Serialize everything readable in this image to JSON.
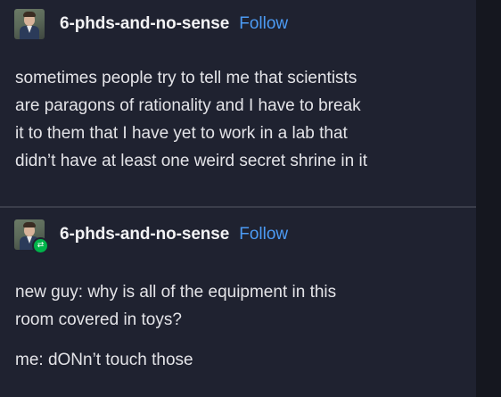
{
  "posts": [
    {
      "username": "6-phds-and-no-sense",
      "follow_label": "Follow",
      "avatar_icon": "user-avatar-icon",
      "lines": [
        "sometimes people try to tell me that scientists",
        "are paragons of rationality and I have to break",
        "it to them that I have yet to work in a lab that",
        "didn’t have at least one weird secret shrine in it"
      ]
    },
    {
      "username": "6-phds-and-no-sense",
      "follow_label": "Follow",
      "avatar_icon": "user-avatar-icon",
      "badge_icon": "reblog-icon",
      "lines": [
        "new guy: why is all of the equipment in this",
        "room covered in toys?"
      ],
      "reply": "me: dONn’t touch those"
    }
  ],
  "colors": {
    "background": "#1f2230",
    "text": "#e4e4e8",
    "follow": "#4c9bf4",
    "reblog_badge": "#00b34a"
  }
}
